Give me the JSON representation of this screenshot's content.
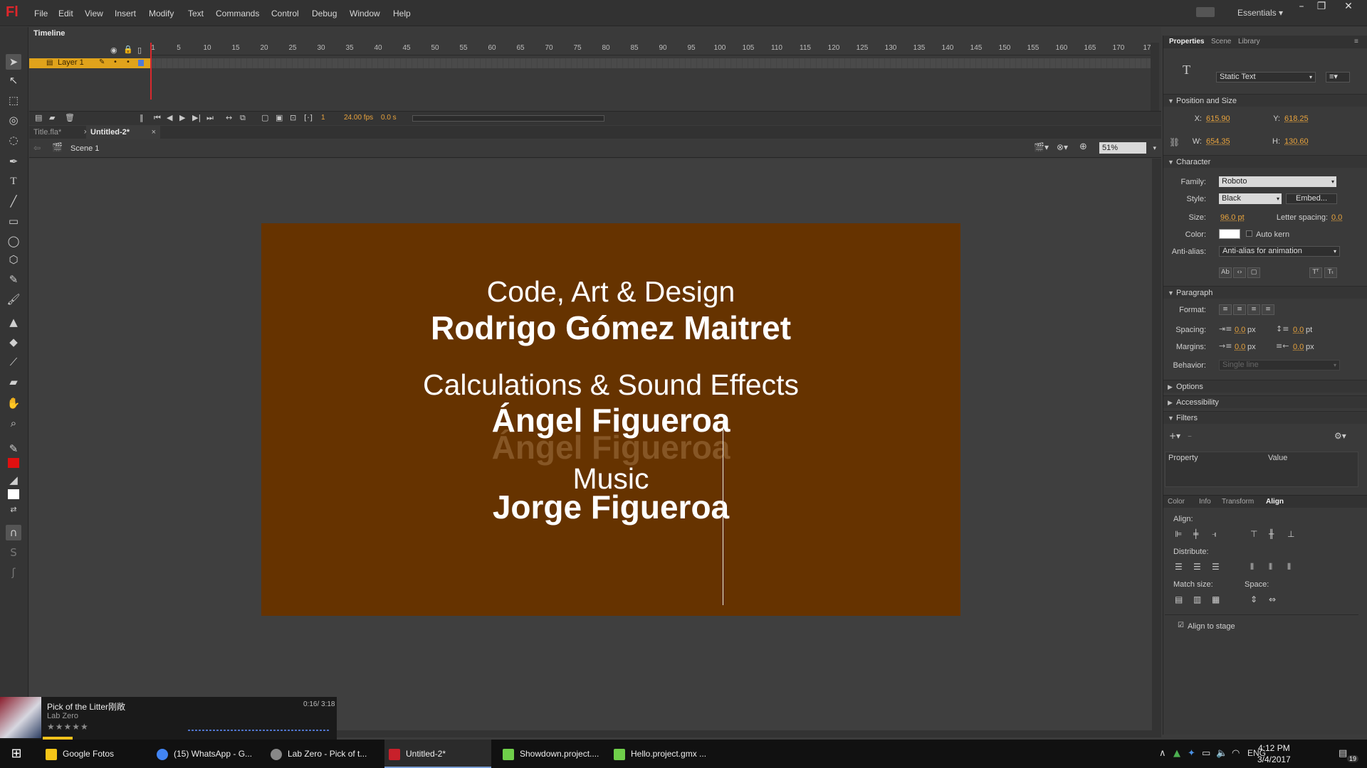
{
  "app": {
    "logo": "Fl",
    "workspace": "Essentials"
  },
  "menu": [
    "File",
    "Edit",
    "View",
    "Insert",
    "Modify",
    "Text",
    "Commands",
    "Control",
    "Debug",
    "Window",
    "Help"
  ],
  "timeline": {
    "tab_label": "Timeline",
    "ruler_ticks": [
      "1",
      "5",
      "10",
      "15",
      "20",
      "25",
      "30",
      "35",
      "40",
      "45",
      "50",
      "55",
      "60",
      "65",
      "70",
      "75",
      "80",
      "85",
      "90",
      "95",
      "100",
      "105",
      "110",
      "115",
      "120",
      "125",
      "130",
      "135",
      "140",
      "145",
      "150",
      "155",
      "160",
      "165",
      "170",
      "17"
    ],
    "layer_name": "Layer 1",
    "current_frame": "1",
    "fps": "24.00 fps",
    "time": "0.0 s"
  },
  "doc_tabs": [
    {
      "label": "Title.fla*"
    },
    {
      "label": "Untitled-2*"
    }
  ],
  "editbar": {
    "scene": "Scene 1",
    "zoom": "51%"
  },
  "stage": {
    "background": "#663300",
    "lines": [
      {
        "text": "Code, Art & Design",
        "style": "light"
      },
      {
        "text": "Rodrigo Gómez Maitret",
        "style": "bold"
      },
      {
        "text": "Calculations & Sound Effects",
        "style": "light"
      },
      {
        "text": "Ángel Figueroa",
        "style": "bold"
      },
      {
        "text": "Ángel Figueroa",
        "style": "ghost"
      },
      {
        "text": "Music",
        "style": "light"
      },
      {
        "text": "Jorge Figueroa",
        "style": "bold"
      }
    ]
  },
  "properties": {
    "tabs": [
      "Properties",
      "Scene",
      "Library"
    ],
    "text_type": "Static Text",
    "position_size": {
      "header": "Position and Size",
      "x_label": "X:",
      "x": "615.90",
      "y_label": "Y:",
      "y": "618.25",
      "w_label": "W:",
      "w": "654.35",
      "h_label": "H:",
      "h": "130.60"
    },
    "character": {
      "header": "Character",
      "family_label": "Family:",
      "family": "Roboto",
      "style_label": "Style:",
      "style": "Black",
      "embed": "Embed...",
      "size_label": "Size:",
      "size": "96.0 pt",
      "spacing_label": "Letter spacing:",
      "spacing": "0.0",
      "color_label": "Color:",
      "autokern": "Auto kern",
      "antialias_label": "Anti-alias:",
      "antialias": "Anti-alias for animation"
    },
    "paragraph": {
      "header": "Paragraph",
      "format_label": "Format:",
      "spacing_label": "Spacing:",
      "spacing1": "0.0",
      "unit_px": "px",
      "spacing2": "0.0",
      "unit_pt": "pt",
      "margins_label": "Margins:",
      "margin1": "0.0",
      "margin2": "0.0",
      "behavior_label": "Behavior:",
      "behavior": "Single line"
    },
    "options_header": "Options",
    "accessibility_header": "Accessibility",
    "filters": {
      "header": "Filters",
      "col_property": "Property",
      "col_value": "Value"
    }
  },
  "align_panel": {
    "tabs": [
      "Color",
      "Info",
      "Transform",
      "Align"
    ],
    "align_label": "Align:",
    "distribute_label": "Distribute:",
    "match_label": "Match size:",
    "space_label": "Space:",
    "align_to_stage": "Align to stage"
  },
  "now_playing": {
    "title": "Pick of the Litter刚敞",
    "artist": "Lab Zero",
    "time": "0:16/ 3:18",
    "stars": "★★★★★"
  },
  "taskbar": {
    "items": [
      {
        "label": "Google Fotos",
        "color": "#f5c518"
      },
      {
        "label": "(15) WhatsApp - G...",
        "color": "#4285f4"
      },
      {
        "label": "Lab Zero - Pick of t...",
        "color": "#888888"
      },
      {
        "label": "Untitled-2*",
        "color": "#c8202a"
      },
      {
        "label": "Showdown.project....",
        "color": "#6fcf4a"
      },
      {
        "label": "Hello.project.gmx ...",
        "color": "#6fcf4a"
      }
    ],
    "lang": "ENG",
    "time": "4:12 PM",
    "date": "3/4/2017",
    "notif": "19"
  }
}
